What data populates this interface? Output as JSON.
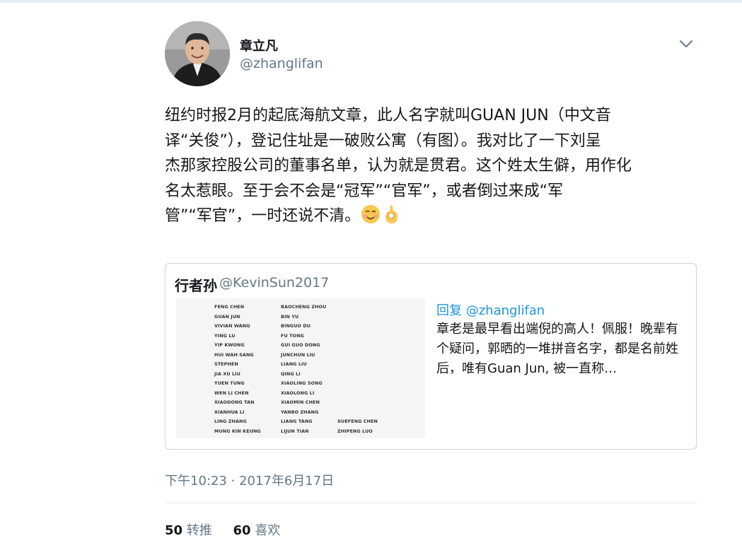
{
  "author": {
    "name": "章立凡",
    "handle": "@zhanglifan"
  },
  "tweet": {
    "text": "纽约时报2月的起底海航文章，此人名字就叫GUAN JUN（中文音\n译“关俊”），登记住址是一破败公寓（有图）。我对比了一下刘呈\n杰那家控股公司的董事名单，认为就是贯君。这个姓太生僻，用作化\n名太惹眼。至于会不会是“冠军”“官军”，或者倒过来成“军\n管”“军官”，一时还说不清。",
    "emoji": [
      "smiling-face-icon",
      "ok-hand-icon"
    ]
  },
  "quote": {
    "name": "行者孙",
    "handle": "@KevinSun2017",
    "reply_to": "回复 @zhanglifan",
    "text": "章老是最早看出端倪的高人！佩服！晚辈有个疑问，郭晒的一堆拼音名字，都是名前姓后，唯有Guan Jun, 被一直称…",
    "image_rows": [
      [
        "FENG CHEN",
        "BAOCHENG ZHOU",
        ""
      ],
      [
        "GUAN JUN",
        "BIN YU",
        ""
      ],
      [
        "VIVIAN WANG",
        "BINGUO DU",
        ""
      ],
      [
        "YING LU",
        "FU TONG",
        ""
      ],
      [
        "YIP KWONG",
        "GUI GUO DONG",
        ""
      ],
      [
        "HUI WAH SANG",
        "JUNCHUN LIU",
        ""
      ],
      [
        "STEPHEN",
        "LIANG LIU",
        ""
      ],
      [
        "JIA XU LIU",
        "QING LI",
        ""
      ],
      [
        "YUEN TUNG",
        "XIAOLING SONG",
        ""
      ],
      [
        "WEN LI CHEN",
        "XIAOLONG LI",
        ""
      ],
      [
        "XIAODONG TAN",
        "XIAOMIN CHEN",
        ""
      ],
      [
        "XIANHUA LI",
        "YANBO ZHANG",
        ""
      ],
      [
        "LING ZHANG",
        "LIANG TANG",
        "XUEFENG CHEN"
      ],
      [
        "MUNG KIN KEUNG",
        "LIJUN TIAN",
        "ZHIPENG LUO"
      ]
    ]
  },
  "timestamp": "下午10:23 · 2017年6月17日",
  "stats": {
    "retweets_count": "50",
    "retweets_label": "转推",
    "likes_count": "60",
    "likes_label": "喜欢"
  },
  "colors": {
    "link": "#1b95e0",
    "secondary_text": "#657786",
    "border": "#ccd6dd"
  }
}
